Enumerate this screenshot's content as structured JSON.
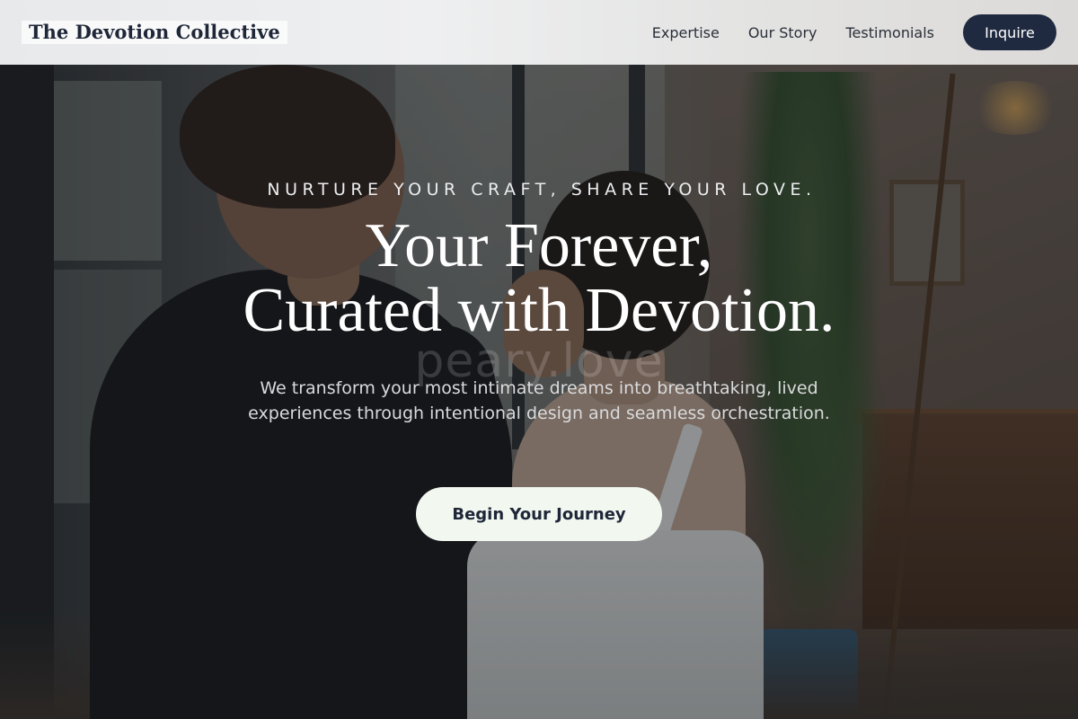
{
  "brand": {
    "name": "The Devotion Collective"
  },
  "nav": {
    "links": [
      "Expertise",
      "Our Story",
      "Testimonials"
    ],
    "cta_label": "Inquire"
  },
  "hero": {
    "eyebrow": "NURTURE YOUR CRAFT, SHARE YOUR LOVE.",
    "headline_line1": "Your Forever,",
    "headline_line2": "Curated with Devotion.",
    "subtext": "We transform your most intimate dreams into breathtaking, lived experiences through intentional design and seamless orchestration.",
    "cta_label": "Begin Your Journey",
    "watermark": "peary.love",
    "background_image": "couple-wedding-dress-interior"
  },
  "colors": {
    "brand_navy": "#1f2a40",
    "cta_bg": "#f2f7f0",
    "nav_bg": "#e8e9eb"
  }
}
